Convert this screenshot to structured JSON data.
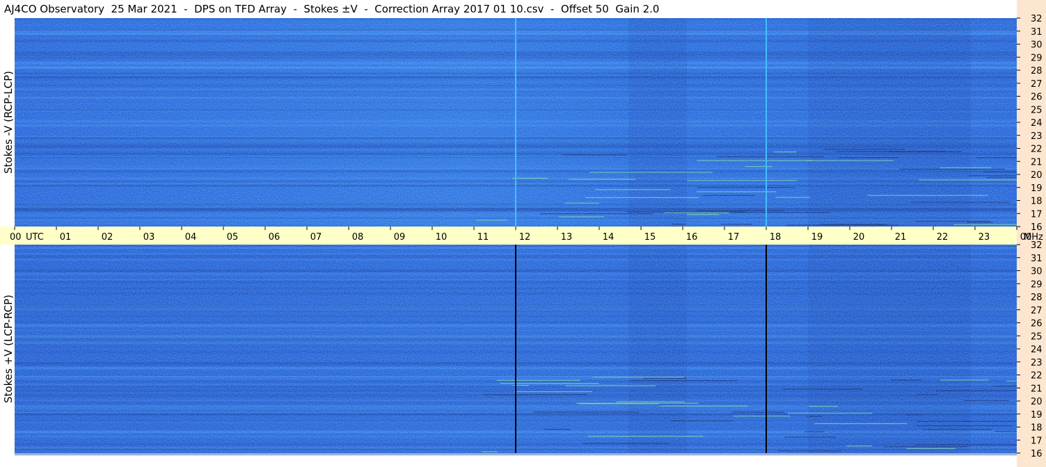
{
  "title": "AJ4CO Observatory  25 Mar 2021  -  DPS on TFD Array  -  Stokes ±V  -  Correction Array 2017 01 10.csv  -  Offset 50  Gain 2.0",
  "colors": {
    "background": "#ffffff",
    "time_axis_strip": "#ffffc8",
    "freq_axis_strip": "#fde6d0",
    "spectrogram_base": "#1e64dc",
    "spectrogram_bright": "#30c8c0",
    "marker_top": "#40c0ff",
    "marker_bottom": "#000000"
  },
  "chart_data": [
    {
      "type": "heatmap",
      "panel": "top",
      "ylabel": "Stokes -V  (RCP-LCP)",
      "y_axis": "right",
      "ylim": [
        16,
        32
      ],
      "yticks": [
        "16",
        "17",
        "18",
        "19",
        "20",
        "21",
        "22",
        "23",
        "24",
        "25",
        "26",
        "27",
        "28",
        "29",
        "30",
        "31",
        "32"
      ],
      "xlim_hours": [
        0,
        24
      ],
      "vertical_markers_hours": [
        12,
        18
      ],
      "marker_color": "#40c0ff"
    },
    {
      "type": "heatmap",
      "panel": "bottom",
      "ylabel": "Stokes +V  (LCP-RCP)",
      "y_axis": "right",
      "ylim": [
        16,
        32
      ],
      "yticks": [
        "16",
        "17",
        "18",
        "19",
        "20",
        "21",
        "22",
        "23",
        "24",
        "25",
        "26",
        "27",
        "28",
        "29",
        "30",
        "31",
        "32"
      ],
      "xlim_hours": [
        0,
        24
      ],
      "vertical_markers_hours": [
        12,
        18
      ],
      "marker_color": "#000000"
    }
  ],
  "time_axis": {
    "ticks": [
      "00",
      "01",
      "02",
      "03",
      "04",
      "05",
      "06",
      "07",
      "08",
      "09",
      "10",
      "11",
      "12",
      "13",
      "14",
      "15",
      "16",
      "17",
      "18",
      "19",
      "20",
      "21",
      "22",
      "23",
      "00"
    ],
    "utc_label": "UTC",
    "unit_label": "MHz"
  }
}
